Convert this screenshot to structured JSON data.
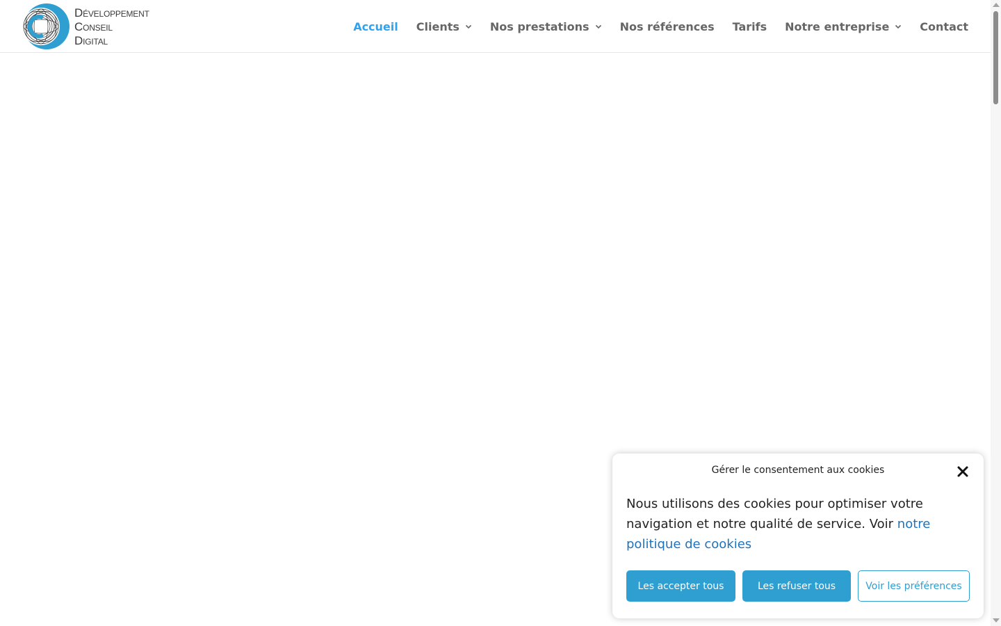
{
  "brand": {
    "line1": "Développement",
    "line2": "Conseil",
    "line3": "Digital",
    "accent_color": "#2f9fd1"
  },
  "nav": {
    "items": [
      {
        "label": "Accueil",
        "active": true,
        "has_dropdown": false
      },
      {
        "label": "Clients",
        "active": false,
        "has_dropdown": true
      },
      {
        "label": "Nos prestations",
        "active": false,
        "has_dropdown": true
      },
      {
        "label": "Nos références",
        "active": false,
        "has_dropdown": false
      },
      {
        "label": "Tarifs",
        "active": false,
        "has_dropdown": false
      },
      {
        "label": "Notre entreprise",
        "active": false,
        "has_dropdown": true
      },
      {
        "label": "Contact",
        "active": false,
        "has_dropdown": false
      }
    ],
    "active_color": "#2ea3f2",
    "text_color": "#666666"
  },
  "cookie_banner": {
    "title": "Gérer le consentement aux cookies",
    "message": "Nous utilisons des cookies pour optimiser votre navigation et notre qualité de service. Voir ",
    "link_text": "notre politique de cookies",
    "accept_label": "Les accepter tous",
    "refuse_label": "Les refuser tous",
    "preferences_label": "Voir les préférences",
    "close_icon": "close-icon"
  }
}
